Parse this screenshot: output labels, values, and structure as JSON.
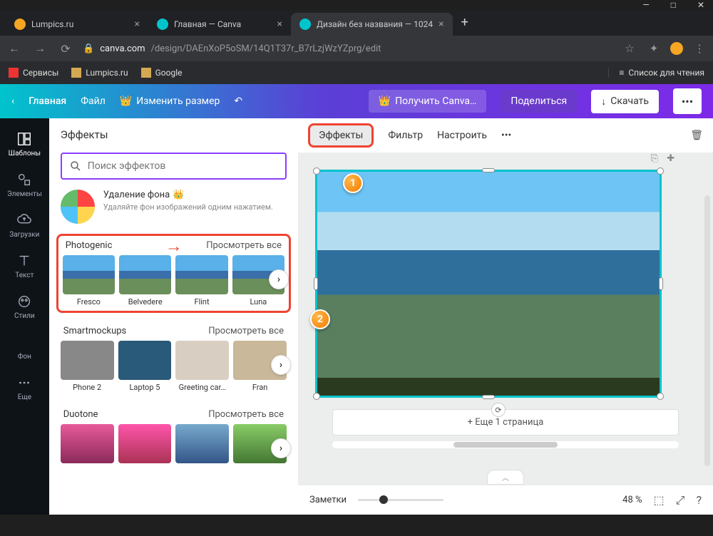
{
  "window": {
    "minimize": "—",
    "maximize": "□",
    "close": "✕"
  },
  "tabs": [
    {
      "icon": "orange",
      "title": "Lumpics.ru",
      "active": false
    },
    {
      "icon": "canva",
      "title": "Главная — Canva",
      "active": false
    },
    {
      "icon": "canva",
      "title": "Дизайн без названия — 1024",
      "active": true
    }
  ],
  "newtab": "+",
  "address": {
    "back": "←",
    "forward": "→",
    "reload": "⟳",
    "lock": "🔒",
    "domain": "canva.com",
    "path": "/design/DAEnXoP5oSM/14Q1T37r_B7rLzjWzYZprg/edit",
    "star": "☆",
    "ext1": "✦",
    "ext2": "⋮"
  },
  "bookmarks": {
    "services": "Сервисы",
    "lumpics": "Lumpics.ru",
    "google": "Google",
    "reading_icon": "≡",
    "reading": "Список для чтения"
  },
  "header": {
    "back": "‹",
    "home": "Главная",
    "file": "Файл",
    "resize": "Изменить размер",
    "undo": "↶",
    "getcanva": "Получить Canva…",
    "share": "Поделиться",
    "download_icon": "↓",
    "download": "Скачать",
    "more": "•••"
  },
  "sidenav": [
    {
      "icon": "templates",
      "label": "Шаблоны"
    },
    {
      "icon": "elements",
      "label": "Элементы"
    },
    {
      "icon": "uploads",
      "label": "Загрузки"
    },
    {
      "icon": "text",
      "label": "Текст"
    },
    {
      "icon": "styles",
      "label": "Стили"
    },
    {
      "icon": "bg",
      "label": "Фон"
    },
    {
      "icon": "more",
      "label": "Еще"
    }
  ],
  "effects": {
    "title": "Эффекты",
    "search_placeholder": "Поиск эффектов",
    "bg_remove_title": "Удаление фона",
    "bg_remove_crown": "👑",
    "bg_remove_desc": "Удаляйте фон изображений одним нажатием.",
    "photogenic": {
      "title": "Photogenic",
      "see_all": "Просмотреть все",
      "items": [
        "Fresco",
        "Belvedere",
        "Flint",
        "Luna"
      ]
    },
    "smartmockups": {
      "title": "Smartmockups",
      "see_all": "Просмотреть все",
      "items": [
        "Phone 2",
        "Laptop 5",
        "Greeting car…",
        "Fran"
      ]
    },
    "duotone": {
      "title": "Duotone",
      "see_all": "Просмотреть все"
    }
  },
  "canvas_toolbar": {
    "effects": "Эффекты",
    "filter": "Фильтр",
    "adjust": "Настроить",
    "more": "•••",
    "copy": "⎘",
    "new": "✚",
    "trash": "🗑"
  },
  "canvas": {
    "rotate": "⟲",
    "add_page": "+ Еще 1 страница",
    "page_refresh": "⟳"
  },
  "bottom": {
    "notes": "Заметки",
    "zoom": "48 %",
    "pages": "⬚",
    "fullscreen": "⤢",
    "help": "?",
    "expand": "︿"
  },
  "markers": {
    "m1": "1",
    "m2": "2"
  },
  "arrow": "→"
}
